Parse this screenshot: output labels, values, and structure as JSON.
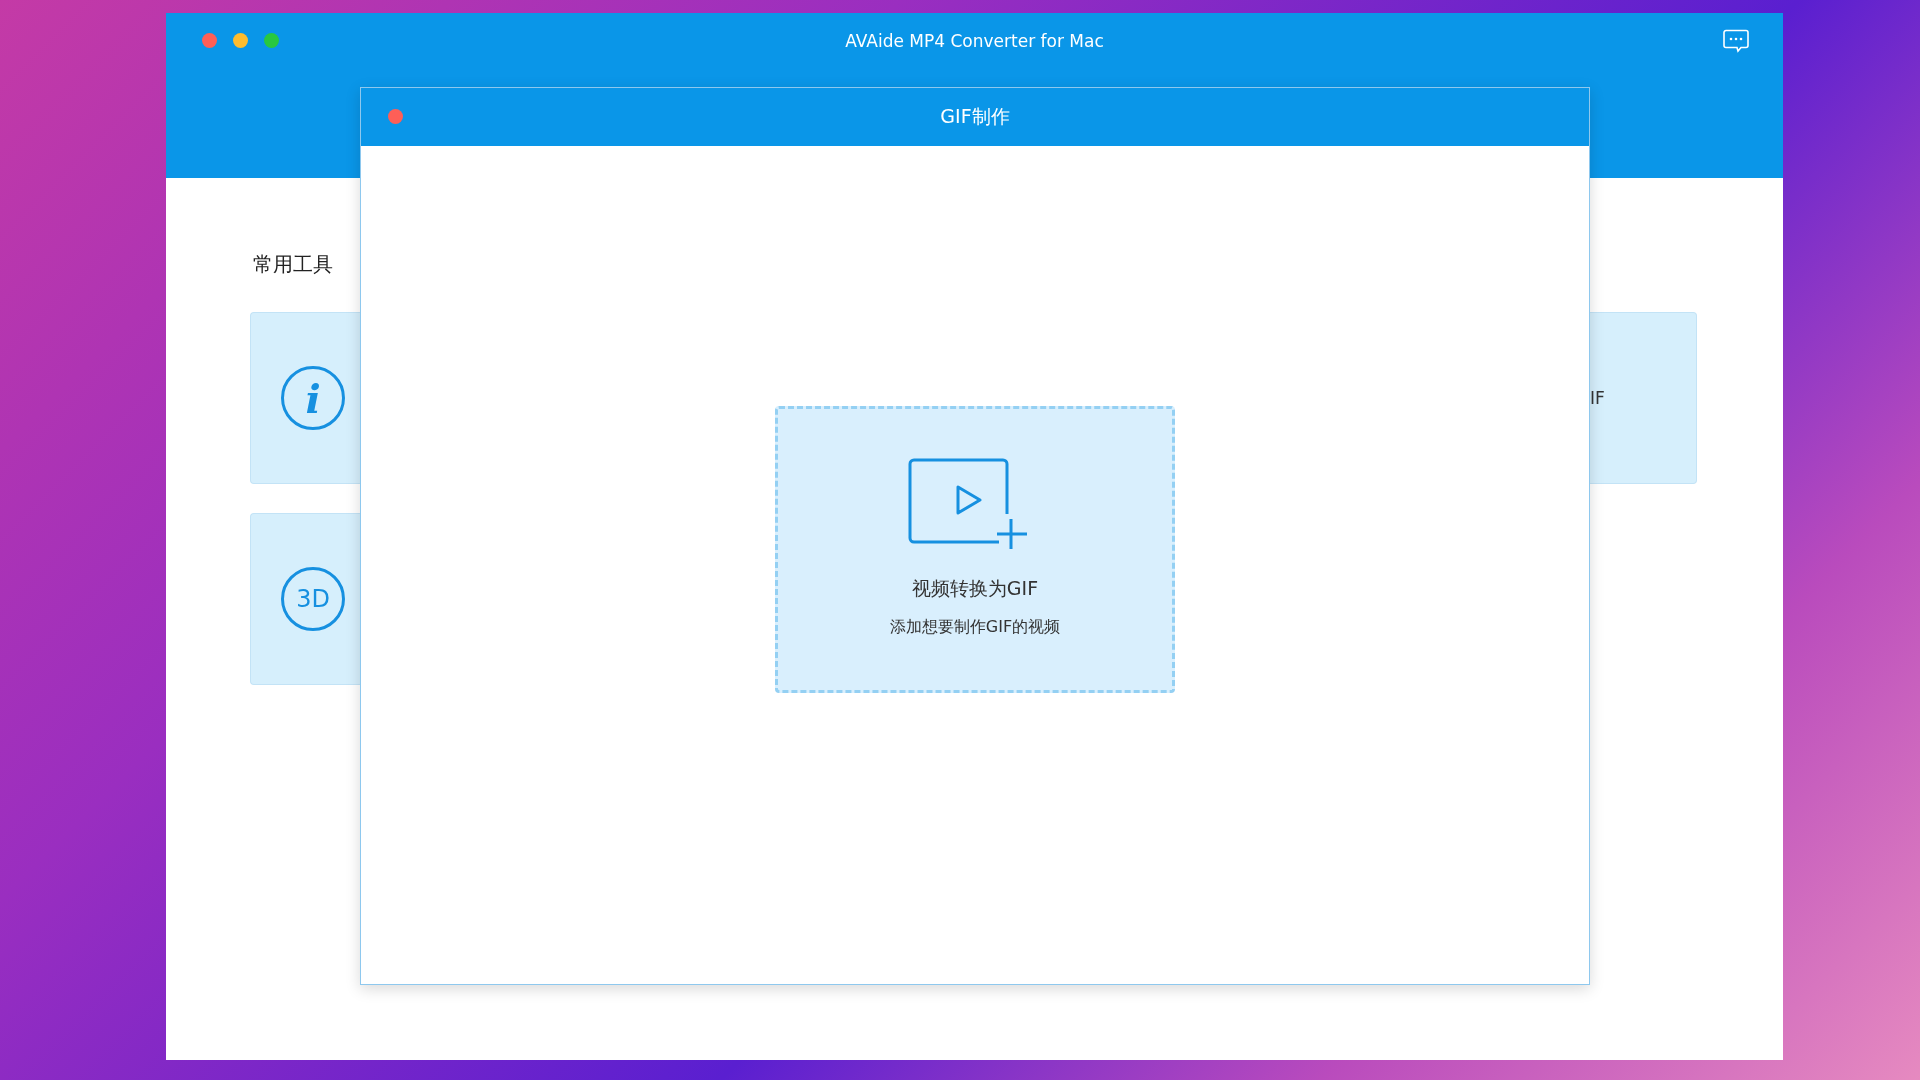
{
  "window": {
    "title": "AVAide MP4 Converter for Mac"
  },
  "section_title": "常用工具",
  "left_cards": [
    {
      "kind": "info",
      "icon_text": "i"
    },
    {
      "kind": "round",
      "icon_text": "3D"
    }
  ],
  "right_card": {
    "label": "IF"
  },
  "dialog": {
    "title": "GIF制作",
    "dropzone": {
      "title": "视频转换为GIF",
      "hint": "添加想要制作GIF的视频"
    }
  }
}
